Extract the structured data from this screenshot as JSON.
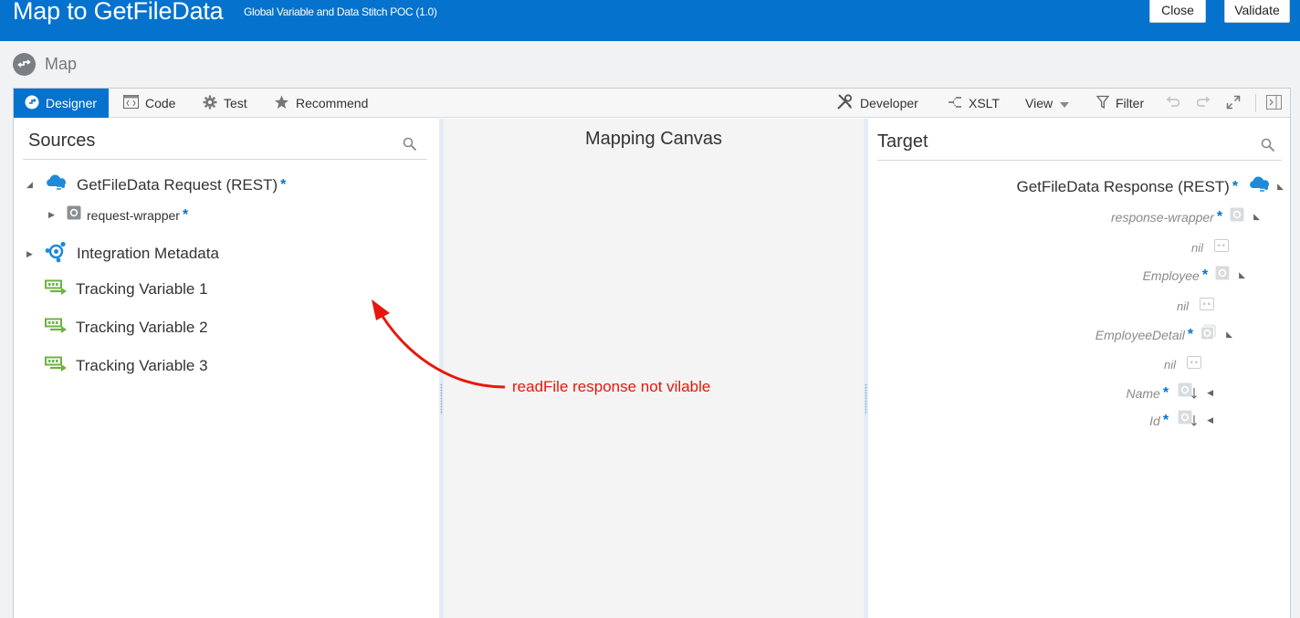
{
  "header": {
    "title": "Map to GetFileData",
    "subtitle": "Global Variable and Data Stitch POC (1.0)",
    "close_label": "Close",
    "validate_label": "Validate"
  },
  "breadcrumb": {
    "label": "Map"
  },
  "toolbar": {
    "designer": "Designer",
    "code": "Code",
    "test": "Test",
    "recommend": "Recommend",
    "developer": "Developer",
    "xslt": "XSLT",
    "view": "View",
    "filter": "Filter"
  },
  "sources": {
    "title": "Sources",
    "items": [
      {
        "label": "GetFileData Request (REST)",
        "required": "*"
      },
      {
        "label": "request-wrapper",
        "required": "*"
      },
      {
        "label": "Integration Metadata"
      },
      {
        "label": "Tracking Variable 1"
      },
      {
        "label": "Tracking Variable 2"
      },
      {
        "label": "Tracking Variable 3"
      }
    ]
  },
  "canvas": {
    "title": "Mapping Canvas"
  },
  "target": {
    "title": "Target",
    "items": [
      {
        "label": "GetFileData Response (REST)",
        "required": "*"
      },
      {
        "label": "response-wrapper",
        "required": "*"
      },
      {
        "label": "nil"
      },
      {
        "label": "Employee",
        "required": "*"
      },
      {
        "label": "nil"
      },
      {
        "label": "EmployeeDetail",
        "required": "*"
      },
      {
        "label": "nil"
      },
      {
        "label": "Name",
        "required": "*"
      },
      {
        "label": "Id",
        "required": "*"
      }
    ]
  },
  "annotation": {
    "text": "readFile response not vilable"
  },
  "colors": {
    "header_blue": "#0572ce",
    "tracking_green": "#6db33f",
    "annotation_red": "#e8170c"
  }
}
